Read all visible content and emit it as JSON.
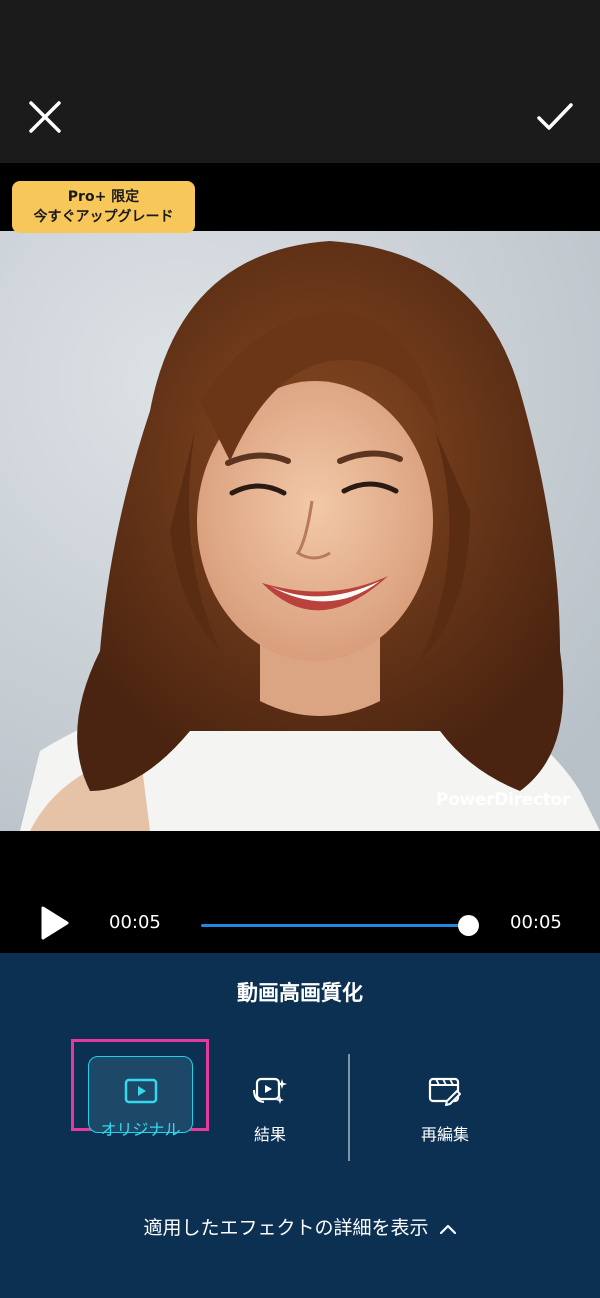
{
  "header": {
    "close_icon": "close-icon",
    "confirm_icon": "checkmark-icon"
  },
  "viewer": {
    "pro_badge": {
      "line1": "Pro+ 限定",
      "line2": "今すぐアップグレード",
      "color": "#f8c75a"
    },
    "watermark": "PowerDirector"
  },
  "player": {
    "current_time": "00:05",
    "total_time": "00:05",
    "progress": 1.0,
    "accent": "#1e88e5"
  },
  "panel": {
    "title": "動画高画質化",
    "options": [
      {
        "label": "オリジナル",
        "icon": "play-frame-icon",
        "selected": true
      },
      {
        "label": "結果",
        "icon": "sparkle-video-icon",
        "selected": false
      },
      {
        "label": "再編集",
        "icon": "edit-clip-icon",
        "selected": false
      }
    ],
    "details_text": "適用したエフェクトの詳細を表示",
    "highlight_color": "#e6399b",
    "selected_color": "#1fd0e6"
  }
}
